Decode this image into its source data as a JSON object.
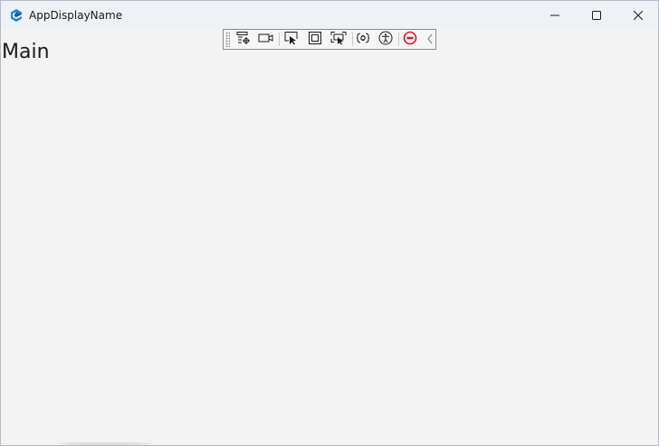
{
  "window": {
    "title": "AppDisplayName",
    "icon": "app-logo-icon",
    "controls": {
      "minimize_icon": "minimize-icon",
      "maximize_icon": "maximize-icon",
      "close_icon": "close-icon"
    }
  },
  "debug_toolbar": {
    "buttons": [
      {
        "name": "live-visual-tree-button",
        "icon": "visual-tree-icon"
      },
      {
        "name": "record-button",
        "icon": "video-camera-icon"
      },
      {
        "name": "select-element-button",
        "icon": "select-element-icon"
      },
      {
        "name": "display-layout-adorners-button",
        "icon": "layout-adorner-icon"
      },
      {
        "name": "track-focused-element-button",
        "icon": "track-focus-icon"
      },
      {
        "name": "hot-reload-button",
        "icon": "hot-reload-icon"
      },
      {
        "name": "accessibility-button",
        "icon": "accessibility-icon"
      },
      {
        "name": "disable-button",
        "icon": "stop-icon"
      },
      {
        "name": "collapse-toolbar-button",
        "icon": "chevron-left-icon"
      }
    ],
    "accent_color": "#e81123"
  },
  "main": {
    "title": "Main"
  },
  "colors": {
    "titlebar_bg": "#eef2f7",
    "content_bg": "#f3f3f3",
    "brand": "#0a74d6"
  }
}
